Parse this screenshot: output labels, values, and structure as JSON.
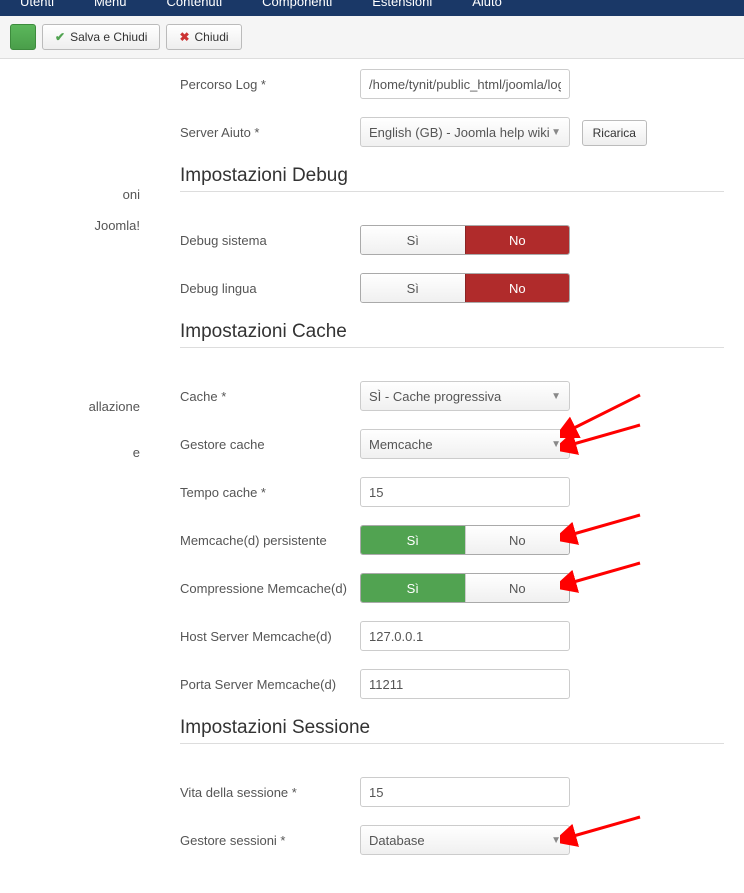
{
  "nav": {
    "item1": "Utenti",
    "item2": "Menu",
    "item3": "Contenuti",
    "item4": "Componenti",
    "item5": "Estensioni",
    "item6": "Aiuto"
  },
  "toolbar": {
    "save_close": "Salva e Chiudi",
    "close": "Chiudi"
  },
  "sidebar": {
    "item1": "oni",
    "item2": "Joomla!",
    "item3": "allazione",
    "item4": "e"
  },
  "top_fields": {
    "log_path_label": "Percorso Log *",
    "log_path_value": "/home/tynit/public_html/joomla/logs",
    "help_server_label": "Server Aiuto *",
    "help_server_value": "English (GB) - Joomla help wiki",
    "reload_label": "Ricarica"
  },
  "debug": {
    "heading": "Impostazioni Debug",
    "system_label": "Debug sistema",
    "lang_label": "Debug lingua",
    "si": "Sì",
    "no": "No"
  },
  "cache": {
    "heading": "Impostazioni Cache",
    "cache_label": "Cache *",
    "cache_value": "SÌ - Cache progressiva",
    "handler_label": "Gestore cache",
    "handler_value": "Memcache",
    "time_label": "Tempo cache *",
    "time_value": "15",
    "persistent_label": "Memcache(d) persistente",
    "compress_label": "Compressione Memcache(d)",
    "host_label": "Host Server Memcache(d)",
    "host_value": "127.0.0.1",
    "port_label": "Porta Server Memcache(d)",
    "port_value": "11211",
    "si": "Sì",
    "no": "No"
  },
  "session": {
    "heading": "Impostazioni Sessione",
    "life_label": "Vita della sessione *",
    "life_value": "15",
    "handler_label": "Gestore sessioni *",
    "handler_value": "Database"
  }
}
